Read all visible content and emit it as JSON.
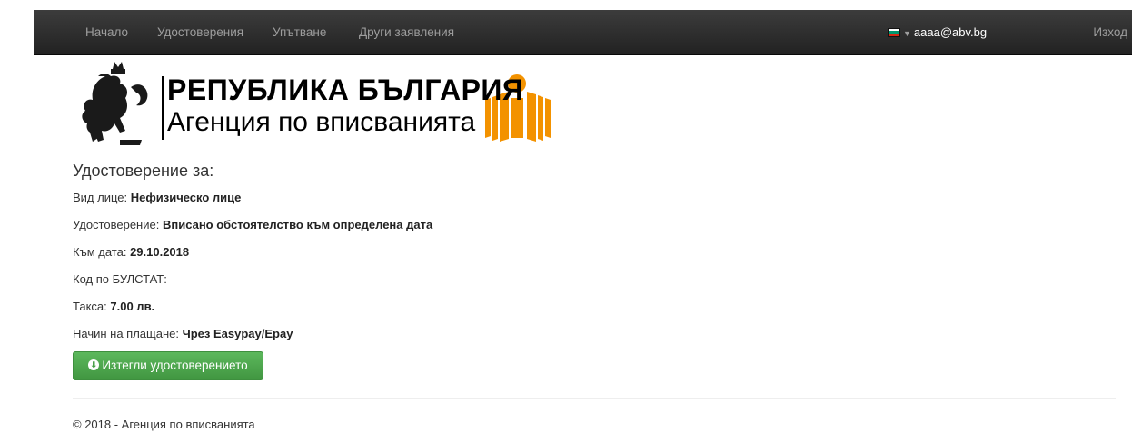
{
  "navbar": {
    "items": [
      {
        "label": "Начало"
      },
      {
        "label": "Удостоверения"
      },
      {
        "label": "Упътване"
      },
      {
        "label": "Други заявления"
      }
    ],
    "user_email": "aaaa@abv.bg",
    "logout_label": "Изход",
    "flag_colors": [
      "#ffffff",
      "#00966e",
      "#d62612"
    ]
  },
  "logo": {
    "line1": "РЕПУБЛИКА БЪЛГАРИЯ",
    "line2": "Агенция по вписванията",
    "accent_color": "#f39200"
  },
  "certificate": {
    "heading": "Удостоверение за:",
    "fields": [
      {
        "label": "Вид лице:",
        "value": "Нефизическо лице"
      },
      {
        "label": "Удостоверение:",
        "value": "Вписано обстоятелство към определена дата"
      },
      {
        "label": "Към дата:",
        "value": "29.10.2018"
      },
      {
        "label": "Код по БУЛСТАТ:",
        "value": ""
      },
      {
        "label": "Такса:",
        "value": "7.00 лв."
      },
      {
        "label": "Начин на плащане:",
        "value": "Чрез Easypay/Epay"
      }
    ],
    "download_button": "Изтегли удостоверението",
    "download_icon": "download-circle-icon",
    "button_color": "#5cb85c"
  },
  "footer": {
    "text": "© 2018 - Агенция по вписванията"
  }
}
